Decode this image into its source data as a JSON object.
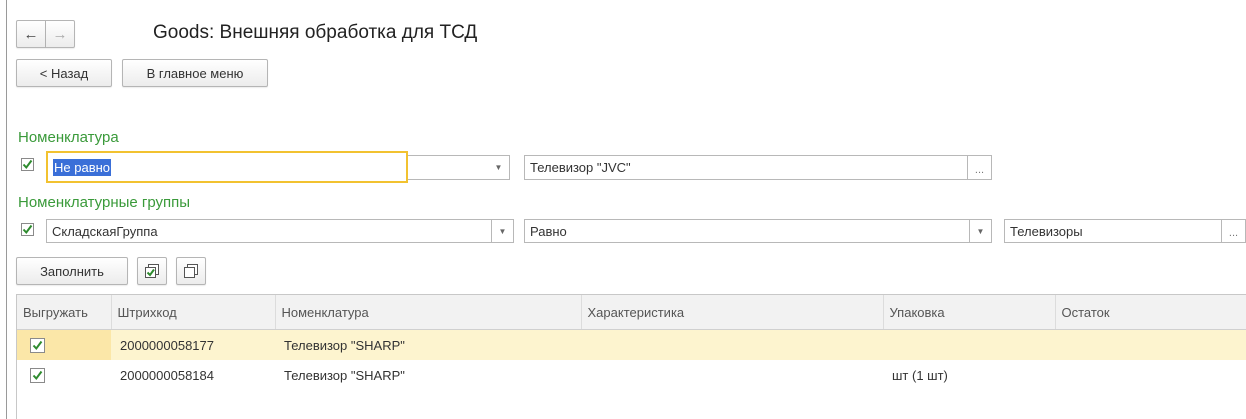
{
  "window": {
    "title": "Goods: Внешняя обработка для ТСД"
  },
  "nav": {
    "back_arrow": "←",
    "forward_arrow": "→"
  },
  "toolbar": {
    "back_label": "< Назад",
    "main_menu_label": "В главное меню"
  },
  "filter_nomenclature": {
    "section_label": "Номенклатура",
    "checked": true,
    "condition_value": "Не равно",
    "value": "Телевизор \"JVC\"",
    "ellipsis": "..."
  },
  "filter_groups": {
    "section_label": "Номенклатурные группы",
    "checked": true,
    "field_value": "СкладскаяГруппа",
    "condition_value": "Равно",
    "value": "Телевизоры",
    "ellipsis": "..."
  },
  "actions": {
    "fill_label": "Заполнить",
    "check_all_icon": "check-all-icon",
    "uncheck_all_icon": "uncheck-all-icon"
  },
  "table": {
    "columns": [
      "Выгружать",
      "Штрихкод",
      "Номенклатура",
      "Характеристика",
      "Упаковка",
      "Остаток"
    ],
    "rows": [
      {
        "export": true,
        "barcode": "2000000058177",
        "nomenclature": "Телевизор \"SHARP\"",
        "characteristic": "",
        "package": "",
        "balance": ""
      },
      {
        "export": true,
        "barcode": "2000000058184",
        "nomenclature": "Телевизор \"SHARP\"",
        "characteristic": "",
        "package": "шт (1 шт)",
        "balance": ""
      }
    ]
  },
  "colors": {
    "section_green": "#3a9a3a",
    "selected_row": "#fdf4cf",
    "focus_border": "#f2c230",
    "selection_blue": "#3a6fd8"
  }
}
